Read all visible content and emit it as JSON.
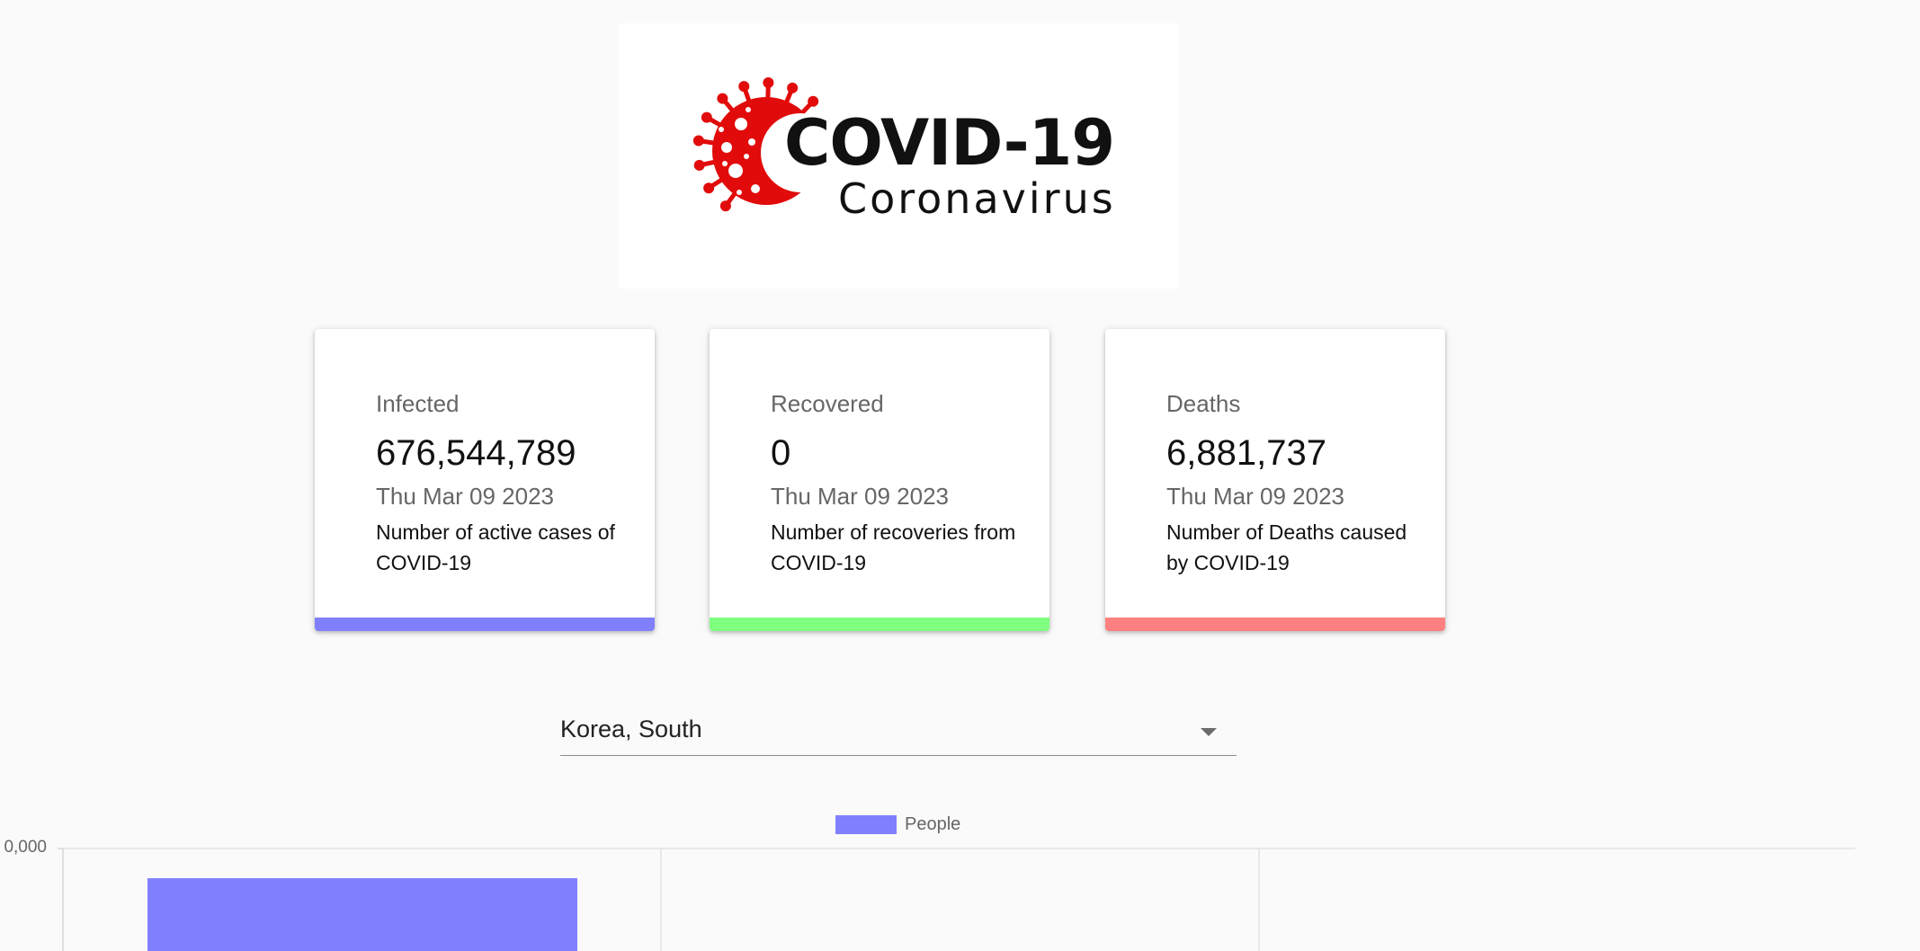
{
  "logo": {
    "title": "COVID-19",
    "subtitle": "Coronavirus",
    "virus_color": "#e10b0b",
    "virus_icon": "coronavirus-icon"
  },
  "cards": [
    {
      "label": "Infected",
      "value": "676,544,789",
      "date": "Thu Mar 09 2023",
      "description": "Number of active cases of COVID-19",
      "color": "#8080ff"
    },
    {
      "label": "Recovered",
      "value": "0",
      "date": "Thu Mar 09 2023",
      "description": "Number of recoveries from COVID-19",
      "color": "#80ff80"
    },
    {
      "label": "Deaths",
      "value": "6,881,737",
      "date": "Thu Mar 09 2023",
      "description": "Number of Deaths caused by COVID-19",
      "color": "#ff8080"
    }
  ],
  "country_select": {
    "selected": "Korea, South",
    "icon": "chevron-down-icon"
  },
  "chart_data": {
    "type": "bar",
    "series": [
      {
        "name": "People",
        "color": "#8080ff"
      }
    ],
    "legend_position": "top-center",
    "y_tick_labels": [
      "0,000"
    ],
    "grid": true
  }
}
